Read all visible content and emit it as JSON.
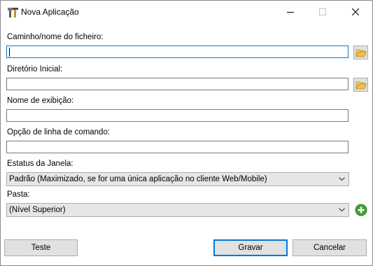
{
  "window": {
    "title": "Nova Aplicação",
    "controls": [
      "minimize",
      "maximize",
      "close"
    ]
  },
  "form": {
    "path": {
      "label": "Caminho/nome do ficheiro:",
      "value": ""
    },
    "start_dir": {
      "label": "Diretório Inicial:",
      "value": ""
    },
    "display_name": {
      "label": "Nome de exibição:",
      "value": ""
    },
    "cmdline": {
      "label": "Opção de linha de comando:",
      "value": ""
    },
    "window_state": {
      "label": "Estatus da Janela:",
      "selected": "Padrão (Maximizado, se for uma única aplicação no cliente Web/Mobile)"
    },
    "folder": {
      "label": "Pasta:",
      "selected": "(Nível Superior)"
    }
  },
  "buttons": {
    "test": "Teste",
    "save": "Gravar",
    "cancel": "Cancelar"
  },
  "icons": {
    "app": "app-tools-icon",
    "browse": "folder-open-icon",
    "add": "plus-circle-icon"
  },
  "colors": {
    "accent": "#0078d7",
    "add_green": "#3fa535",
    "folder_yellow": "#e8c14f"
  }
}
